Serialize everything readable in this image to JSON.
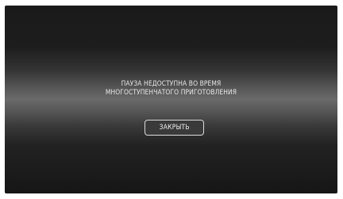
{
  "dialog": {
    "message_line1": "ПАУЗА НЕДОСТУПНА ВО ВРЕМЯ",
    "message_line2": "МНОГОСТУПЕНЧАТОГО ПРИГОТОВЛЕНИЯ",
    "close_label": "ЗАКРЫТЬ"
  }
}
